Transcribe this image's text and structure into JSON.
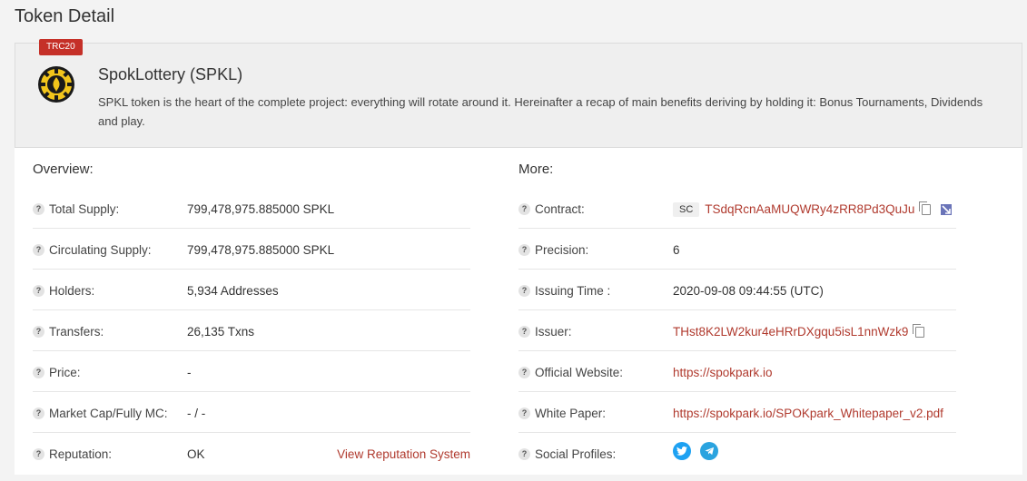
{
  "page_title": "Token Detail",
  "token": {
    "badge": "TRC20",
    "name": "SpokLottery (SPKL)",
    "description": "SPKL token is the heart of the complete project: everything will rotate around it. Hereinafter a recap of main benefits deriving by holding it: Bonus Tournaments, Dividends and play.",
    "logo_icon": "token-logo-icon"
  },
  "overview": {
    "title": "Overview:",
    "rows": [
      {
        "label": "Total Supply:",
        "value": "799,478,975.885000 SPKL"
      },
      {
        "label": "Circulating Supply:",
        "value": "799,478,975.885000 SPKL"
      },
      {
        "label": "Holders:",
        "value": "5,934 Addresses"
      },
      {
        "label": "Transfers:",
        "value": "26,135 Txns"
      },
      {
        "label": "Price:",
        "value": "-"
      },
      {
        "label": "Market Cap/Fully MC:",
        "value": "- / -"
      },
      {
        "label": "Reputation:",
        "value": "OK",
        "link": "View Reputation System"
      }
    ]
  },
  "more": {
    "title": "More:",
    "rows": [
      {
        "label": "Contract:",
        "tag": "SC",
        "value": "TSdqRcnAaMUQWRy4zRR8Pd3QuJu"
      },
      {
        "label": "Precision:",
        "value": "6"
      },
      {
        "label": "Issuing Time :",
        "value": "2020-09-08 09:44:55 (UTC)"
      },
      {
        "label": "Issuer:",
        "value": "THst8K2LW2kur4eHRrDXgqu5isL1nnWzk9"
      },
      {
        "label": "Official Website:",
        "value": "https://spokpark.io"
      },
      {
        "label": "White Paper:",
        "value": "https://spokpark.io/SPOKpark_Whitepaper_v2.pdf"
      },
      {
        "label": "Social Profiles:",
        "icons": [
          "twitter-icon",
          "telegram-icon"
        ]
      }
    ]
  },
  "question_mark": "?",
  "colors": {
    "accent": "#b03a2e",
    "badge": "#c53028",
    "twitter": "#1da1f2",
    "telegram": "#2aa3df"
  }
}
